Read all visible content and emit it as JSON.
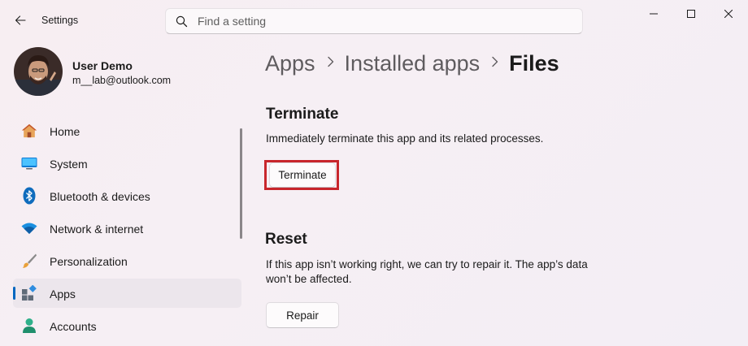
{
  "window": {
    "title": "Settings",
    "back_icon": "arrow-left",
    "controls": [
      "minimize",
      "maximize",
      "close"
    ]
  },
  "search": {
    "placeholder": "Find a setting",
    "value": ""
  },
  "user": {
    "name": "User Demo",
    "email": "m__lab@outlook.com"
  },
  "sidebar": {
    "items": [
      {
        "label": "Home",
        "icon": "home-icon"
      },
      {
        "label": "System",
        "icon": "monitor-icon"
      },
      {
        "label": "Bluetooth & devices",
        "icon": "bluetooth-icon"
      },
      {
        "label": "Network & internet",
        "icon": "wifi-icon"
      },
      {
        "label": "Personalization",
        "icon": "brush-icon"
      },
      {
        "label": "Apps",
        "icon": "apps-icon",
        "active": true
      },
      {
        "label": "Accounts",
        "icon": "person-icon"
      }
    ]
  },
  "breadcrumb": [
    "Apps",
    "Installed apps",
    "Files"
  ],
  "terminate": {
    "title": "Terminate",
    "description": "Immediately terminate this app and its related processes.",
    "button_label": "Terminate"
  },
  "reset": {
    "title": "Reset",
    "description_line1": "If this app isn’t working right, we can try to repair it. The app’s data",
    "description_line2": "won’t be affected.",
    "repair_label": "Repair"
  },
  "colors": {
    "accent": "#0067c0",
    "highlight_border": "#c8262c"
  }
}
